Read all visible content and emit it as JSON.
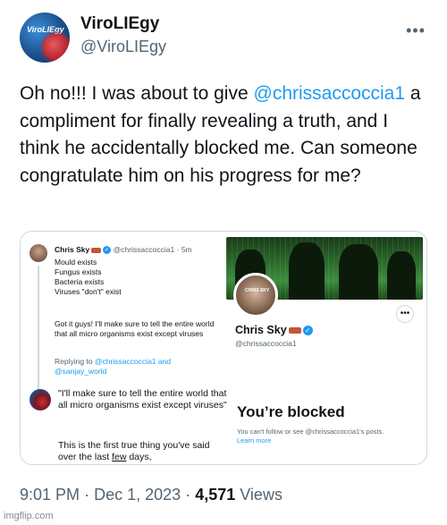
{
  "tweet": {
    "display_name": "ViroLIEgy",
    "handle": "@ViroLIEgy",
    "avatar_logo": "ViroLIEgy",
    "text_before": "Oh no!!! I was about to give ",
    "mention": "@chrissaccoccia1",
    "text_after": " a compliment for finally revealing a truth, and I think he accidentally blocked me. Can someone congratulate him on his progress for me?",
    "more_icon": "more-horizontal-icon",
    "time": "9:01 PM",
    "date": "Dec 1, 2023",
    "views_count": "4,571",
    "views_label": "Views",
    "separator": "·"
  },
  "quoted_post": {
    "author_name": "Chris Sky",
    "author_handle": "@chrissaccoccia1",
    "age": "5m",
    "lines": [
      "Mould exists",
      "Fungus exists",
      "Bacteria exists",
      "Viruses \"don't\" exist"
    ],
    "followup": "Got it guys!  I'll make sure to tell the entire world that all micro organisms exist except viruses",
    "replying_label": "Replying to",
    "replying_mention_1": "@chrissaccoccia1",
    "replying_and": "and",
    "replying_mention_2": "@sanjay_world"
  },
  "reply_post": {
    "quote": "\"I'll make sure to tell the entire world that all micro organisms exist except viruses\"",
    "body_before": "This is the first true thing you've said over the last ",
    "body_underlined": "few",
    "body_after": " days,"
  },
  "profile": {
    "name": "Chris Sky",
    "handle": "@chrissaccoccia1",
    "avatar_text": "CHRIS SKY",
    "more_icon": "more-horizontal-icon",
    "blocked_title": "You’re blocked",
    "blocked_text": "You can't follow or see @chrissaccoccia1's posts.",
    "learn_more": "Learn more"
  },
  "watermark": "imgflip.com",
  "colors": {
    "link": "#1d9bf0",
    "text": "#0f1419",
    "muted": "#536471",
    "border": "#cfd9de"
  }
}
